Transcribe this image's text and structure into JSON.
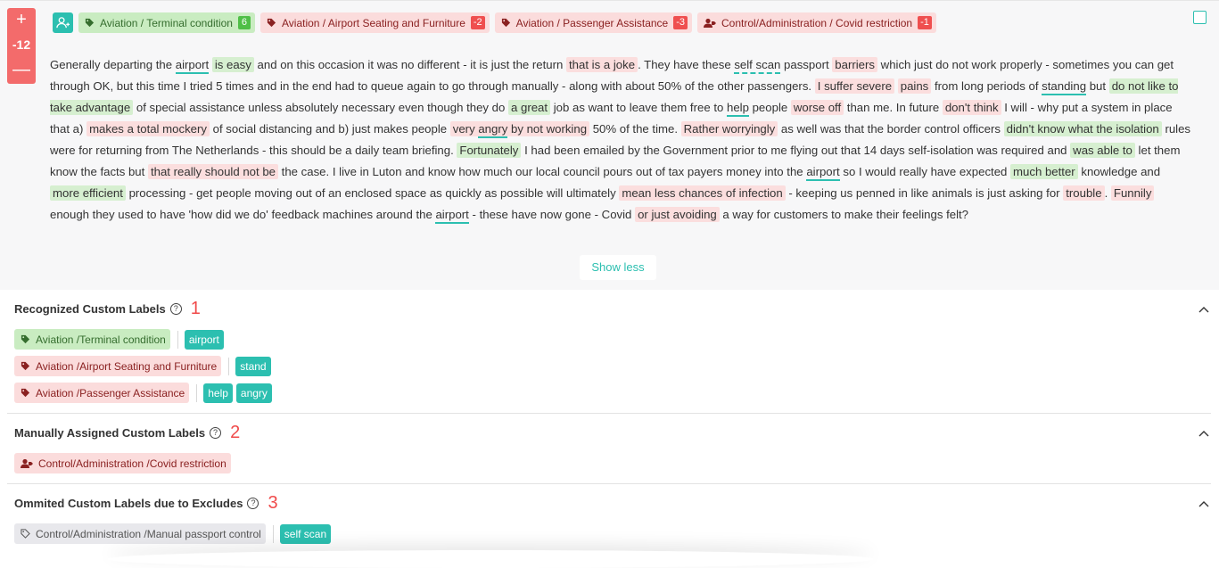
{
  "review": {
    "score": "-12",
    "plus_label": "+",
    "minus_label": "—",
    "top_tags": [
      {
        "label": "Aviation / Terminal condition",
        "count": "6",
        "tone": "green",
        "icon": "tag-icon"
      },
      {
        "label": "Aviation / Airport Seating and Furniture",
        "count": "-2",
        "tone": "red",
        "icon": "tag-icon"
      },
      {
        "label": "Aviation / Passenger Assistance",
        "count": "-3",
        "tone": "red",
        "icon": "tag-icon"
      },
      {
        "label": "Control/Administration / Covid restriction",
        "count": "-1",
        "tone": "red",
        "icon": "user-tag-icon"
      }
    ],
    "text": [
      "Generally departing the ",
      "airport",
      " ",
      "is easy",
      " and on this occasion it was no different - it is just the return ",
      "that is a joke",
      ". They have these ",
      "self scan",
      " passport ",
      "barriers",
      " which just do not work properly - sometimes you can get through OK, but this time I tried 5 times and in the end had to queue again to go through manually - along with about 50% of the other passengers. ",
      "I suffer severe",
      " ",
      "pains",
      " from long periods of ",
      "standing",
      " but ",
      "do not like to take advantage",
      " of special assistance unless absolutely necessary even though they do ",
      "a great",
      " job as want to leave them free to ",
      "help",
      " people ",
      "worse off",
      " than me. In future ",
      "don't think",
      " I will - why put a system in place that a) ",
      "makes a total mockery",
      " of social distancing and b) just makes people ",
      "very ",
      "angry",
      " by not working",
      " 50% of the time. ",
      "Rather worryingly",
      " as well was that the border control officers ",
      "didn't know what the isolation",
      " rules were for returning from The Netherlands - this should be a daily team briefing. ",
      "Fortunately",
      " I had been emailed by the Government prior to me flying out that 14 days self-isolation was required and ",
      "was able to",
      " let them know the facts but ",
      "that really should not be",
      " the case. I live in Luton and know how much our local council pours out of tax payers money into the ",
      "airport",
      " so I would really have expected ",
      "much better",
      " knowledge and ",
      "more efficient",
      " processing - get people moving out of an enclosed space as quickly as possible will ultimately ",
      "mean less chances of infection",
      " - keeping us penned in like animals is just asking for ",
      "trouble",
      ". ",
      "Funnily",
      " enough they used to have 'how did we do' feedback machines around the ",
      "airport",
      " - these have now gone - Covid ",
      "or just avoiding",
      " a way for customers to make their feelings felt?"
    ],
    "show_less_label": "Show less"
  },
  "recognized": {
    "title": "Recognized Custom Labels",
    "number": "1",
    "rows": [
      {
        "label": "Aviation /Terminal condition",
        "tone": "green",
        "keywords": [
          "airport"
        ]
      },
      {
        "label": "Aviation /Airport Seating and Furniture",
        "tone": "red",
        "keywords": [
          "stand"
        ]
      },
      {
        "label": "Aviation /Passenger Assistance",
        "tone": "red",
        "keywords": [
          "help",
          "angry"
        ]
      }
    ]
  },
  "manual": {
    "title": "Manually Assigned Custom Labels",
    "number": "2",
    "rows": [
      {
        "label": "Control/Administration /Covid restriction",
        "tone": "red"
      }
    ]
  },
  "omitted": {
    "title": "Ommited Custom Labels due to Excludes",
    "number": "3",
    "rows": [
      {
        "label": "Control/Administration /Manual passport control",
        "tone": "gray",
        "keywords": [
          "self scan"
        ]
      }
    ]
  },
  "colors": {
    "accent": "#2cbfb0",
    "negative": "#f36b6b",
    "positive_bg": "#d6efd0",
    "negative_bg": "#fbdede"
  }
}
